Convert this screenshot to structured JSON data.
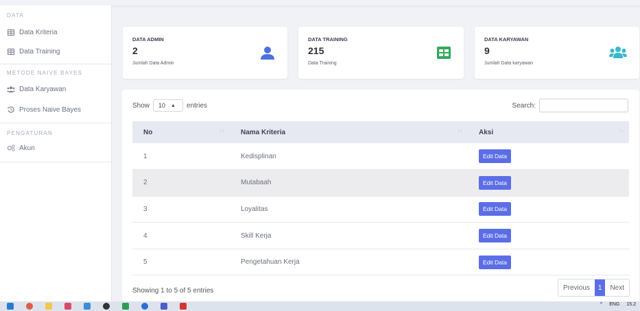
{
  "sidebar": {
    "sections": [
      {
        "heading": "DATA",
        "items": [
          {
            "label": "Data Kriteria",
            "icon": "table-icon"
          },
          {
            "label": "Data Training",
            "icon": "table-icon"
          }
        ]
      },
      {
        "heading": "METODE NAIVE BAYES",
        "items": [
          {
            "label": "Data Karyawan",
            "icon": "users-icon"
          },
          {
            "label": "Proses Naive Bayes",
            "icon": "history-icon"
          }
        ]
      },
      {
        "heading": "PENGATURAN",
        "items": [
          {
            "label": "Akun",
            "icon": "cogs-icon"
          }
        ]
      }
    ]
  },
  "cards": [
    {
      "title": "DATA ADMIN",
      "value": "2",
      "sub": "Jumlah Data Admin",
      "icon": "user-icon",
      "color": "#4e6fe0"
    },
    {
      "title": "DATA TRAINING",
      "value": "215",
      "sub": "Data Training",
      "icon": "table-icon",
      "color": "#2eaa5c"
    },
    {
      "title": "DATA KARYAWAN",
      "value": "9",
      "sub": "Jumlah Data karyawan",
      "icon": "users-icon",
      "color": "#36b9cc"
    }
  ],
  "table": {
    "show_label": "Show",
    "entries_value": "10",
    "entries_label": "entries",
    "search_label": "Search:",
    "columns": [
      "No",
      "Nama Kriteria",
      "Aksi"
    ],
    "rows": [
      {
        "no": "1",
        "nama": "Kedisplinan",
        "action": "Edit Data"
      },
      {
        "no": "2",
        "nama": "Mutabaah",
        "action": "Edit Data"
      },
      {
        "no": "3",
        "nama": "Loyalitas",
        "action": "Edit Data"
      },
      {
        "no": "4",
        "nama": "Skill Kerja",
        "action": "Edit Data"
      },
      {
        "no": "5",
        "nama": "Pengetahuan Kerja",
        "action": "Edit Data"
      }
    ],
    "info": "Showing 1 to 5 of 5 entries",
    "pagination": {
      "previous": "Previous",
      "current": "1",
      "next": "Next"
    }
  },
  "taskbar": {
    "lang": "ENG",
    "time": "15.2"
  }
}
